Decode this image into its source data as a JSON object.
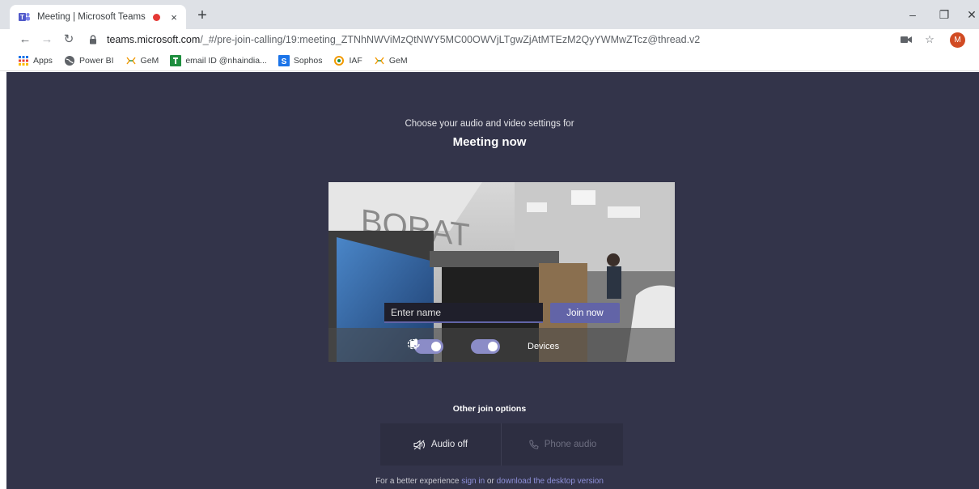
{
  "browser": {
    "tab_title": "Meeting | Microsoft Teams",
    "tab_close": "×",
    "new_tab": "+",
    "window_minimize": "–",
    "window_restore": "❐",
    "window_close": "✕",
    "url_domain": "teams.microsoft.com",
    "url_path": "/_#/pre-join-calling/19:meeting_ZTNhNWViMzQtNWY5MC00OWVjLTgwZjAtMTEzM2QyYWMwZTcz@thread.v2",
    "profile_initial": "M",
    "bookmarks": [
      {
        "label": "Apps",
        "icon": "apps-grid-icon"
      },
      {
        "label": "Power BI",
        "icon": "globe-icon"
      },
      {
        "label": "GeM",
        "icon": "gem-logo-icon"
      },
      {
        "label": "email ID @nhaindia...",
        "icon": "green-logo-icon"
      },
      {
        "label": "Sophos",
        "icon": "sophos-logo-icon"
      },
      {
        "label": "IAF",
        "icon": "iaf-roundel-icon"
      },
      {
        "label": "GeM",
        "icon": "gem-logo-icon"
      }
    ]
  },
  "prejoin": {
    "choose_text": "Choose your audio and video settings for",
    "meeting_title": "Meeting now",
    "name_placeholder": "Enter name",
    "join_label": "Join now",
    "devices_label": "Devices",
    "camera_on": true,
    "mic_on": true,
    "other_options_label": "Other join options",
    "audio_off_label": "Audio off",
    "phone_audio_label": "Phone audio",
    "footer_prefix": "For a better experience ",
    "footer_sign_in": "sign in",
    "footer_middle": " or ",
    "footer_download": "download the desktop version"
  },
  "colors": {
    "teams_bg": "#33344a",
    "accent": "#6264a7",
    "toggle_on": "#8b8cc7",
    "link": "#8e90d9"
  }
}
